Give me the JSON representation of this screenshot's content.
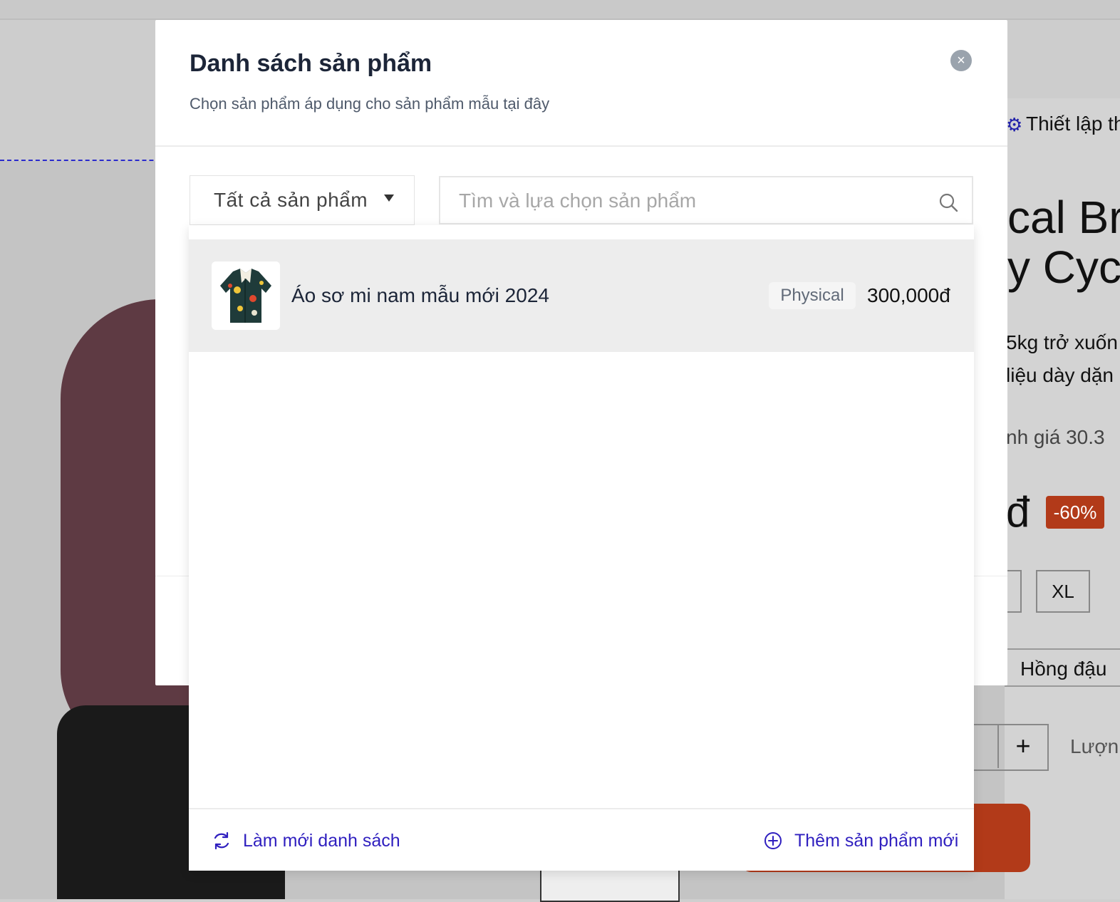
{
  "background": {
    "settings_label": "Thiết lập th",
    "product_title": "cal Br\ny Cycle",
    "description": "5kg trở xuốn\nliệu dày dặn",
    "rating_text": "nh giá    30.3",
    "price_suffix": "đ",
    "discount_badge": "-60%",
    "size_option": "XL",
    "color_option": "Hồng đậu",
    "quantity_plus": "+",
    "quantity_label": "Lượn"
  },
  "modal": {
    "title": "Danh sách sản phẩm",
    "subtitle": "Chọn sản phẩm áp dụng cho sản phẩm mẫu tại đây",
    "close_symbol": "×"
  },
  "filter": {
    "selected": "Tất cả sản phẩm"
  },
  "search": {
    "placeholder": "Tìm và lựa chọn sản phẩm",
    "value": ""
  },
  "products": [
    {
      "name": "Áo sơ mi nam mẫu mới 2024",
      "type": "Physical",
      "price": "300,000đ"
    }
  ],
  "footer": {
    "refresh_label": "Làm mới danh sách",
    "add_label": "Thêm sản phẩm mới"
  },
  "colors": {
    "link": "#2f1fbf",
    "title": "#1c2538",
    "discount": "#b23a19"
  }
}
